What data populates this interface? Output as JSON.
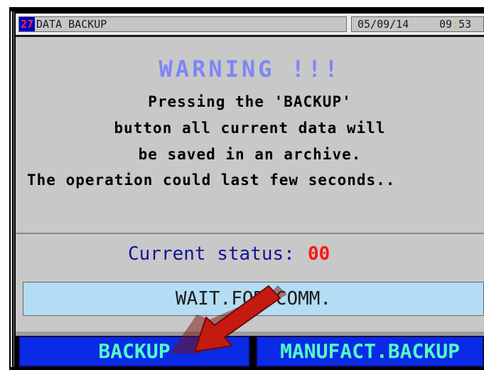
{
  "titlebar": {
    "screen_number": "27",
    "title": "DATA BACKUP",
    "date": "05/09/14",
    "time_hours": "09",
    "time_sep": ":",
    "time_minutes": "53"
  },
  "message": {
    "warning": "WARNING !!!",
    "line1": "Pressing the 'BACKUP'",
    "line2": "button all current data will",
    "line3": "be saved in an archive.",
    "line4": "The operation could last few seconds.."
  },
  "status": {
    "label": "Current status:",
    "value": "00",
    "state_text": "WAIT.FOR COMM."
  },
  "buttons": {
    "backup": "BACKUP",
    "manufact_backup": "MANUFACT.BACKUP"
  },
  "colors": {
    "button_bg": "#0a2ae6",
    "button_text": "#50ffc8",
    "warning": "#7e86f6",
    "status_value": "#ff1414",
    "arrow": "#c41a12"
  },
  "icons": {
    "annotation_arrow": "arrow-pointer-icon"
  }
}
